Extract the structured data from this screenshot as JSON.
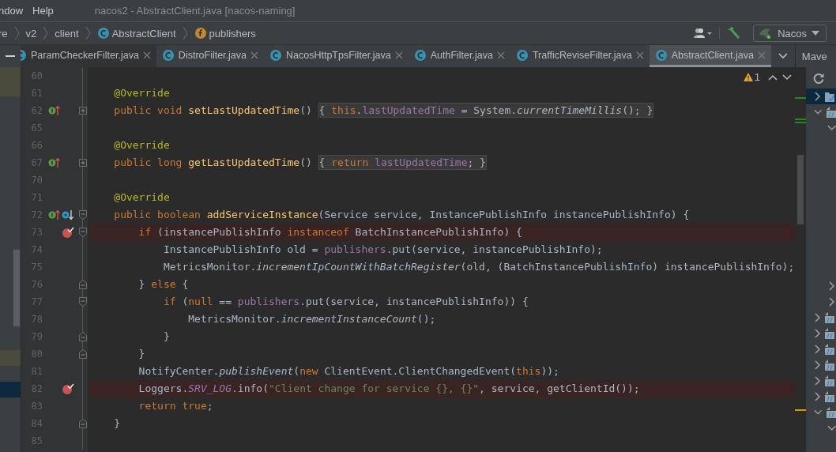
{
  "menu": [
    {
      "label": "ndow"
    },
    {
      "label": "Help"
    }
  ],
  "window_title": "nacos2 - AbstractClient.java [nacos-naming]",
  "breadcrumbs": [
    {
      "label": "re",
      "kind": "folder"
    },
    {
      "label": "v2",
      "kind": "folder"
    },
    {
      "label": "client",
      "kind": "folder"
    },
    {
      "label": "AbstractClient",
      "kind": "class"
    },
    {
      "label": "publishers",
      "kind": "field"
    }
  ],
  "run_config": {
    "label": "Nacos"
  },
  "tabs": [
    {
      "label": "ParamCheckerFilter.java",
      "selected": false
    },
    {
      "label": "DistroFilter.java",
      "selected": false
    },
    {
      "label": "NacosHttpTpsFilter.java",
      "selected": false
    },
    {
      "label": "AuthFilter.java",
      "selected": false
    },
    {
      "label": "TrafficReviseFilter.java",
      "selected": false
    },
    {
      "label": "AbstractClient.java",
      "selected": true
    }
  ],
  "tool_window": {
    "title": "Mave"
  },
  "editor": {
    "warning_count": "1",
    "lines": [
      {
        "number": "60",
        "breakpoint": false
      },
      {
        "number": "61",
        "breakpoint": false,
        "tokens": [
          {
            "kind": "annot",
            "t": "    @Override"
          }
        ]
      },
      {
        "number": "62",
        "breakpoint": false,
        "marks": [
          {
            "kind": "implements"
          }
        ],
        "fold": {
          "kind": "collapsed"
        },
        "tokens": [
          {
            "kind": "kw",
            "t": "    public void "
          },
          {
            "kind": "decl",
            "t": "setLastUpdatedTime"
          },
          {
            "kind": "plain",
            "t": "() "
          },
          {
            "kind": "fold",
            "parts": [
              {
                "kind": "plain",
                "t": "{ "
              },
              {
                "kind": "kw",
                "t": "this"
              },
              {
                "kind": "plain",
                "t": "."
              },
              {
                "kind": "field",
                "t": "lastUpdatedTime"
              },
              {
                "kind": "plain",
                "t": " = System."
              },
              {
                "kind": "static",
                "t": "currentTimeMillis"
              },
              {
                "kind": "plain",
                "t": "(); }"
              }
            ]
          }
        ]
      },
      {
        "number": "65",
        "breakpoint": false
      },
      {
        "number": "66",
        "breakpoint": false,
        "tokens": [
          {
            "kind": "annot",
            "t": "    @Override"
          }
        ]
      },
      {
        "number": "67",
        "breakpoint": false,
        "marks": [
          {
            "kind": "implements"
          }
        ],
        "fold": {
          "kind": "collapsed"
        },
        "tokens": [
          {
            "kind": "kw",
            "t": "    public long "
          },
          {
            "kind": "decl",
            "t": "getLastUpdatedTime"
          },
          {
            "kind": "plain",
            "t": "() "
          },
          {
            "kind": "fold",
            "parts": [
              {
                "kind": "plain",
                "t": "{ "
              },
              {
                "kind": "kw",
                "t": "return "
              },
              {
                "kind": "field",
                "t": "lastUpdatedTime"
              },
              {
                "kind": "plain",
                "t": "; }"
              }
            ]
          }
        ]
      },
      {
        "number": "70",
        "breakpoint": false
      },
      {
        "number": "71",
        "breakpoint": false,
        "tokens": [
          {
            "kind": "annot",
            "t": "    @Override"
          }
        ]
      },
      {
        "number": "72",
        "breakpoint": false,
        "marks": [
          {
            "kind": "implements"
          },
          {
            "kind": "overridden"
          }
        ],
        "fold": {
          "kind": "start"
        },
        "tokens": [
          {
            "kind": "kw",
            "t": "    public boolean "
          },
          {
            "kind": "decl",
            "t": "addServiceInstance"
          },
          {
            "kind": "plain",
            "t": "(Service service, InstancePublishInfo instancePublishInfo) {"
          }
        ]
      },
      {
        "number": "73",
        "breakpoint": true,
        "fold": {
          "kind": "start"
        },
        "tokens": [
          {
            "kind": "kw",
            "t": "        if "
          },
          {
            "kind": "plain",
            "t": "(instancePublishInfo "
          },
          {
            "kind": "kw",
            "t": "instanceof"
          },
          {
            "kind": "plain",
            "t": " BatchInstancePublishInfo) {"
          }
        ]
      },
      {
        "number": "74",
        "breakpoint": false,
        "tokens": [
          {
            "kind": "plain",
            "t": "            InstancePublishInfo old = "
          },
          {
            "kind": "field",
            "t": "publishers"
          },
          {
            "kind": "plain",
            "t": ".put(service, instancePublishInfo);"
          }
        ]
      },
      {
        "number": "75",
        "breakpoint": false,
        "tokens": [
          {
            "kind": "plain",
            "t": "            MetricsMonitor."
          },
          {
            "kind": "static",
            "t": "incrementIpCountWithBatchRegister"
          },
          {
            "kind": "plain",
            "t": "(old, (BatchInstancePublishInfo) instancePublishInfo);"
          }
        ]
      },
      {
        "number": "76",
        "breakpoint": false,
        "fold": {
          "kind": "end"
        },
        "tokens": [
          {
            "kind": "plain",
            "t": "        } "
          },
          {
            "kind": "kw",
            "t": "else"
          },
          {
            "kind": "plain",
            "t": " {"
          }
        ]
      },
      {
        "number": "77",
        "breakpoint": false,
        "fold": {
          "kind": "start"
        },
        "tokens": [
          {
            "kind": "kw",
            "t": "            if "
          },
          {
            "kind": "plain",
            "t": "("
          },
          {
            "kind": "kw",
            "t": "null"
          },
          {
            "kind": "plain",
            "t": " == "
          },
          {
            "kind": "field",
            "t": "publishers"
          },
          {
            "kind": "plain",
            "t": ".put(service, instancePublishInfo)) {"
          }
        ]
      },
      {
        "number": "78",
        "breakpoint": false,
        "tokens": [
          {
            "kind": "plain",
            "t": "                MetricsMonitor."
          },
          {
            "kind": "static",
            "t": "incrementInstanceCount"
          },
          {
            "kind": "plain",
            "t": "();"
          }
        ]
      },
      {
        "number": "79",
        "breakpoint": false,
        "fold": {
          "kind": "end"
        },
        "tokens": [
          {
            "kind": "plain",
            "t": "            }"
          }
        ]
      },
      {
        "number": "80",
        "breakpoint": false,
        "fold": {
          "kind": "end"
        },
        "tokens": [
          {
            "kind": "plain",
            "t": "        }"
          }
        ]
      },
      {
        "number": "81",
        "breakpoint": false,
        "tokens": [
          {
            "kind": "plain",
            "t": "        NotifyCenter."
          },
          {
            "kind": "static",
            "t": "publishEvent"
          },
          {
            "kind": "plain",
            "t": "("
          },
          {
            "kind": "kw",
            "t": "new"
          },
          {
            "kind": "plain",
            "t": " ClientEvent.ClientChangedEvent("
          },
          {
            "kind": "kw",
            "t": "this"
          },
          {
            "kind": "plain",
            "t": "));"
          }
        ]
      },
      {
        "number": "82",
        "breakpoint": true,
        "tokens": [
          {
            "kind": "plain",
            "t": "        Loggers."
          },
          {
            "kind": "sfield",
            "t": "SRV_LOG"
          },
          {
            "kind": "plain",
            "t": ".info("
          },
          {
            "kind": "str",
            "t": "\"Client change for service {}, {}\""
          },
          {
            "kind": "plain",
            "t": ", service, getClientId());"
          }
        ]
      },
      {
        "number": "83",
        "breakpoint": false,
        "tokens": [
          {
            "kind": "kw",
            "t": "        return true"
          },
          {
            "kind": "plain",
            "t": ";"
          }
        ]
      },
      {
        "number": "84",
        "breakpoint": false,
        "fold": {
          "kind": "end"
        },
        "tokens": [
          {
            "kind": "plain",
            "t": "    }"
          }
        ]
      },
      {
        "number": "85",
        "breakpoint": false
      }
    ]
  }
}
